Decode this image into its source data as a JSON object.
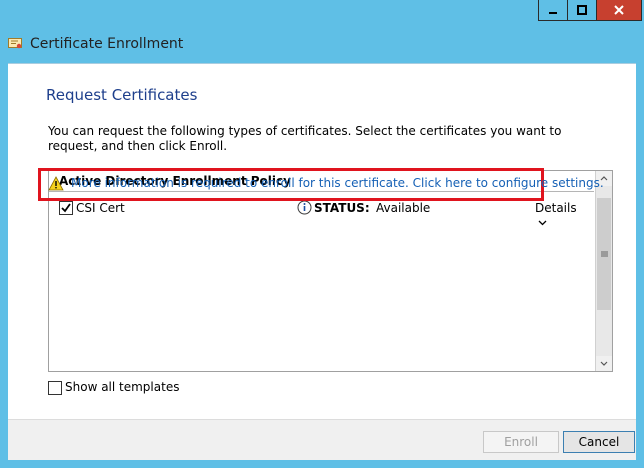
{
  "window": {
    "title": "Certificate Enrollment",
    "controls": [
      "minimize",
      "maximize",
      "close"
    ],
    "accent_color": "#5fbfe6"
  },
  "page": {
    "heading": "Request Certificates",
    "description": "You can request the following types of certificates. Select the certificates you want to request, and then click Enroll."
  },
  "policy_list": {
    "header": "Active Directory Enrollment Policy",
    "items": [
      {
        "name": "CSI Cert",
        "checked": true,
        "status_label": "STATUS:",
        "status_value": "Available",
        "details_label": "Details",
        "info_message": "More information is required to enroll for this certificate. Click here to configure settings."
      }
    ]
  },
  "options": {
    "show_all_templates_label": "Show all templates",
    "show_all_templates_checked": false
  },
  "buttons": {
    "enroll": "Enroll",
    "cancel": "Cancel"
  },
  "colors": {
    "highlight_border": "#e0141e",
    "link": "#1560b5",
    "heading": "#1e3f8c"
  }
}
